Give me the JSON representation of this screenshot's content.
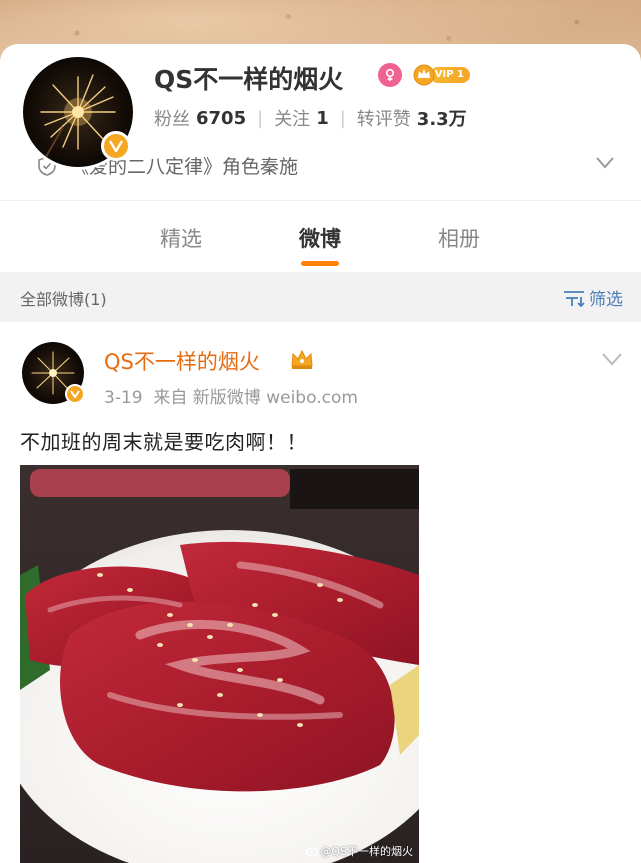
{
  "profile": {
    "name": "QS不一样的烟火",
    "vip_label": "VIP 1",
    "stats": [
      {
        "label": "粉丝",
        "value": "6705"
      },
      {
        "label": "关注",
        "value": "1"
      },
      {
        "label": "转评赞",
        "value": "3.3万"
      }
    ],
    "role": "《爱的二八定律》角色秦施"
  },
  "tabs": [
    {
      "label": "精选",
      "active": false
    },
    {
      "label": "微博",
      "active": true
    },
    {
      "label": "相册",
      "active": false
    }
  ],
  "filter": {
    "left_label": "全部微博(1)",
    "right_label": "筛选"
  },
  "post": {
    "author": "QS不一样的烟火",
    "date": "3-19",
    "source": "来自 新版微博 weibo.com",
    "text": "不加班的周末就是要吃肉啊！！",
    "watermark": "@QS不一样的烟火"
  },
  "colors": {
    "accent": "#ff8200",
    "author_name": "#e86b10",
    "verified": "#f5a623",
    "link_blue": "#4a7fb8"
  }
}
